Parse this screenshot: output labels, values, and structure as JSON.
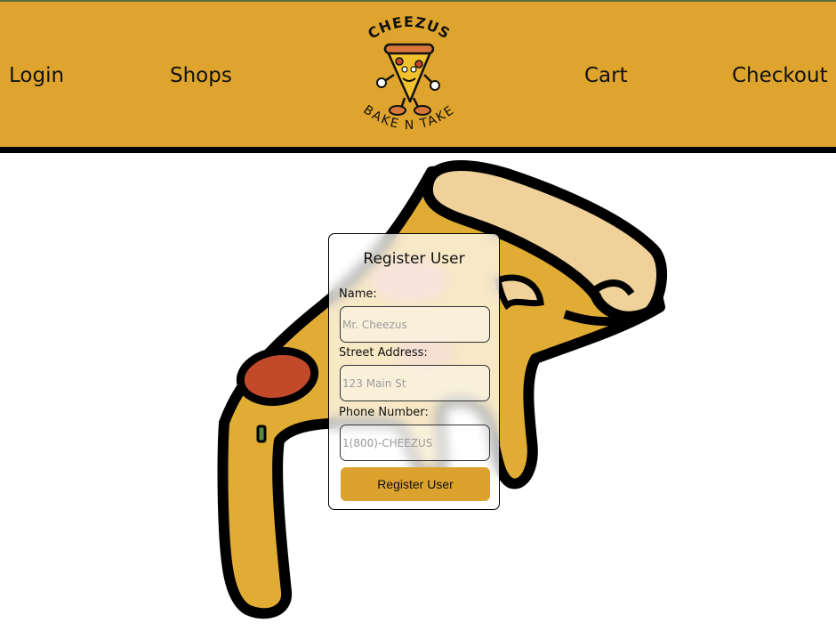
{
  "nav": {
    "login": "Login",
    "shops": "Shops",
    "cart": "Cart",
    "checkout": "Checkout"
  },
  "logo": {
    "top_text": "CHEEZUS",
    "bottom_text": "BAKE N TAKE"
  },
  "form": {
    "title": "Register User",
    "name_label": "Name:",
    "name_placeholder": "Mr. Cheezus",
    "address_label": "Street Address:",
    "address_placeholder": "123 Main St",
    "phone_label": "Phone Number:",
    "phone_placeholder": "1(800)-CHEEZUS",
    "submit_label": "Register User"
  },
  "colors": {
    "header_bg": "#dea42e",
    "button_bg": "#dba22d",
    "cheese": "#e0ac34",
    "crust": "#efd199",
    "pepperoni": "#c2492a"
  }
}
